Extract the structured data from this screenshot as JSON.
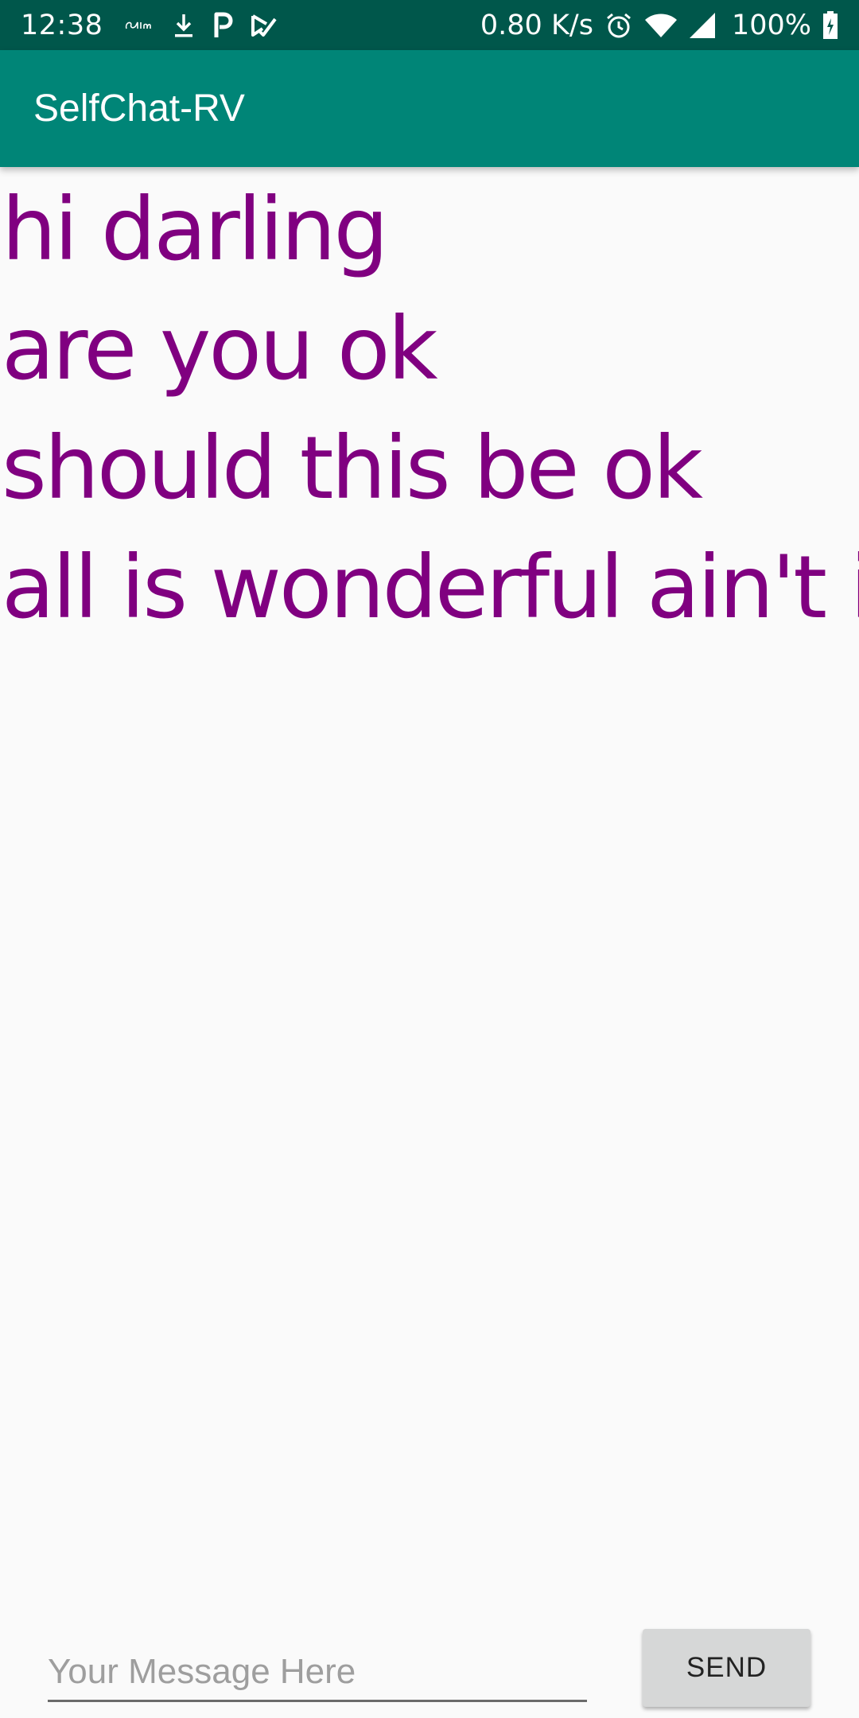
{
  "status_bar": {
    "time": "12:38",
    "net_speed": "0.80 K/s",
    "battery": "100%",
    "left_icons": [
      "calm-icon",
      "download-icon",
      "parking-icon",
      "play-store-icon"
    ],
    "right_icons": [
      "alarm-icon",
      "wifi-icon",
      "signal-icon",
      "battery-icon"
    ]
  },
  "app_bar": {
    "title": "SelfChat-RV"
  },
  "messages": [
    "hi darling",
    "are you ok",
    "should this be ok",
    "all is wonderful ain't it"
  ],
  "composer": {
    "placeholder": "Your Message Here",
    "value": "",
    "send_label": "SEND"
  },
  "colors": {
    "status_bar": "#00574b",
    "app_bar": "#008577",
    "message_text": "#800080",
    "send_button": "#d6d7d7"
  }
}
